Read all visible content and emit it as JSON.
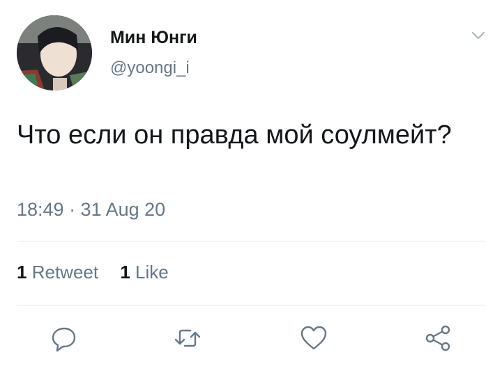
{
  "tweet": {
    "author_name": "Мин Юнги",
    "author_handle": "@yoongi_i",
    "text": "Что если он правда мой соулмейт?",
    "timestamp": "18:49 · 31 Aug 20",
    "stats": {
      "retweets_count": "1",
      "retweets_label": "Retweet",
      "likes_count": "1",
      "likes_label": "Like"
    }
  },
  "icons": {
    "menu": "chevron-down-icon",
    "reply": "reply-icon",
    "retweet": "retweet-icon",
    "like": "heart-icon",
    "share": "share-icon"
  },
  "colors": {
    "text": "#14171a",
    "secondary": "#657786",
    "divider": "#e1e8ed",
    "icon": "#657786"
  }
}
